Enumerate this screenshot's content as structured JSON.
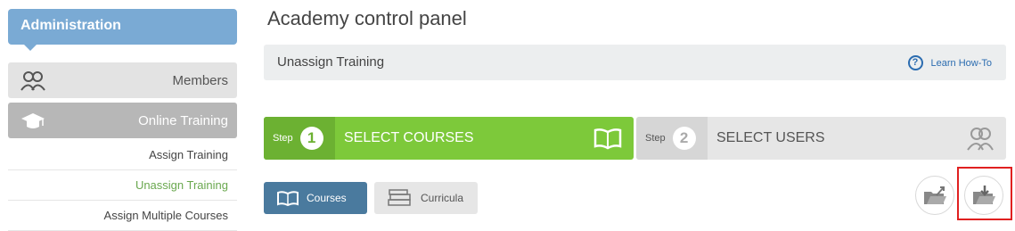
{
  "sidebar": {
    "header": "Administration",
    "members_label": "Members",
    "online_training_label": "Online Training",
    "sub_items": [
      {
        "label": "Assign Training",
        "active": false
      },
      {
        "label": "Unassign Training",
        "active": true
      },
      {
        "label": "Assign Multiple Courses",
        "active": false
      }
    ]
  },
  "main": {
    "title": "Academy control panel",
    "subtitle": "Unassign Training",
    "learn_how_to": "Learn How-To",
    "learn_icon_glyph": "?",
    "steps": [
      {
        "word": "Step",
        "number": "1",
        "title": "SELECT COURSES",
        "icon": "open-book-icon",
        "active": true
      },
      {
        "word": "Step",
        "number": "2",
        "title": "SELECT USERS",
        "icon": "users-icon",
        "active": false
      }
    ],
    "toggle": {
      "courses_label": "Courses",
      "curricula_label": "Curricula"
    },
    "actions": [
      {
        "icon": "export-folder-icon"
      },
      {
        "icon": "import-folder-icon",
        "highlighted": true
      }
    ]
  },
  "colors": {
    "sidebar_header": "#7aaad4",
    "step_active": "#7dc93a",
    "courses_active": "#4a7a9e",
    "link": "#2b6cb0",
    "active_sub_item": "#6aa84f",
    "highlight": "#e02020"
  }
}
